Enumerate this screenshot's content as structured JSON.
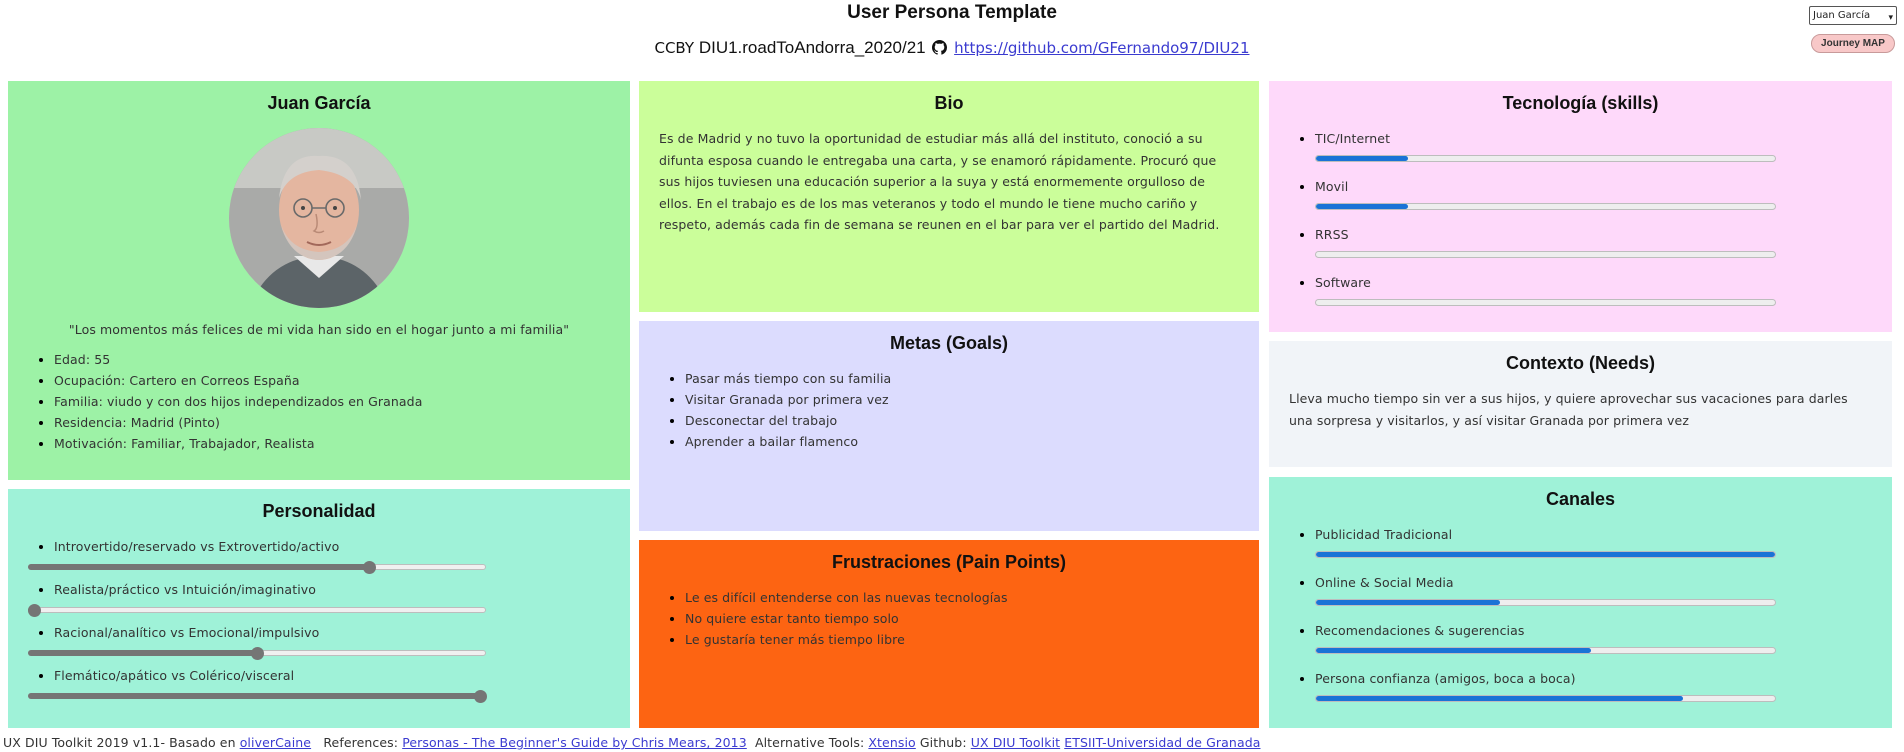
{
  "header": {
    "title": "User Persona Template",
    "cc_text": "CCBY",
    "project": "DIU1.roadToAndorra_2020/21",
    "repo_link": "https://github.com/GFernando97/DIU21"
  },
  "controls": {
    "persona_select_value": "Juan García",
    "journey_button_label": "Journey MAP"
  },
  "profile": {
    "name": "Juan García",
    "quote": "\"Los momentos más felices de mi vida han sido en el hogar junto a mi familia\"",
    "details": [
      "Edad: 55",
      "Ocupación: Cartero en Correos España",
      "Familia: viudo y con dos hijos independizados en Granada",
      "Residencia: Madrid (Pinto)",
      "Motivación: Familiar, Trabajador, Realista"
    ]
  },
  "personality": {
    "title": "Personalidad",
    "traits": [
      {
        "label": "Introvertido/reservado vs Extrovertido/activo",
        "value": 75
      },
      {
        "label": "Realista/práctico vs Intuición/imaginativo",
        "value": 0
      },
      {
        "label": "Racional/analítico vs Emocional/impulsivo",
        "value": 50
      },
      {
        "label": "Flemático/apático vs Colérico/visceral",
        "value": 100
      }
    ]
  },
  "bio": {
    "title": "Bio",
    "text": "Es de Madrid y no tuvo la oportunidad de estudiar más allá del instituto, conoció a su difunta esposa cuando le entregaba una carta, y se enamoró rápidamente. Procuró que sus hijos tuviesen una educación superior a la suya y está enormemente orgulloso de ellos. En el trabajo es de los mas veteranos y todo el mundo le tiene mucho cariño y respeto, además cada fin de semana se reunen en el bar para ver el partido del Madrid."
  },
  "goals": {
    "title": "Metas (Goals)",
    "items": [
      "Pasar más tiempo con su familia",
      "Visitar Granada por primera vez",
      "Desconectar del trabajo",
      "Aprender a bailar flamenco"
    ]
  },
  "frustrations": {
    "title": "Frustraciones (Pain Points)",
    "items": [
      "Le es difícil entenderse con las nuevas tecnologías",
      "No quiere estar tanto tiempo solo",
      "Le gustaría tener más tiempo libre"
    ]
  },
  "tech": {
    "title": "Tecnología (skills)",
    "skills": [
      {
        "label": "TIC/Internet",
        "value": 20
      },
      {
        "label": "Movil",
        "value": 20
      },
      {
        "label": "RRSS",
        "value": 0
      },
      {
        "label": "Software",
        "value": 0
      }
    ]
  },
  "context": {
    "title": "Contexto (Needs)",
    "text": "Lleva mucho tiempo sin ver a sus hijos, y quiere aprovechar sus vacaciones para darles una sorpresa y visitarlos, y así visitar Granada por primera vez"
  },
  "channels": {
    "title": "Canales",
    "items": [
      {
        "label": "Publicidad Tradicional",
        "value": 100
      },
      {
        "label": "Online & Social Media",
        "value": 40
      },
      {
        "label": "Recomendaciones & sugerencias",
        "value": 60
      },
      {
        "label": "Persona confianza (amigos, boca a boca)",
        "value": 80
      }
    ]
  },
  "footer": {
    "toolkit": "UX DIU Toolkit 2019 v1.1- Basado en",
    "oliver_link": "oliverCaine",
    "references_label": "References:",
    "references_link": "Personas - The Beginner's Guide by Chris Mears, 2013",
    "alt_tools_label": "Alternative Tools:",
    "xtensio_link": "Xtensio",
    "github_label": "Github:",
    "uxdiu_link": "UX DIU Toolkit",
    "etsiit_link": "ETSIIT-Universidad de Granada"
  },
  "colors": {
    "profile": "#9df2a6",
    "personality": "#9ff2d8",
    "bio": "#cbfe9a",
    "goals": "#dcdcfe",
    "frustrations": "#fd6412",
    "tech": "#fed9fa",
    "context": "#f1f4f8",
    "channels": "#9ff2d8",
    "progress": "#1a73d6"
  }
}
